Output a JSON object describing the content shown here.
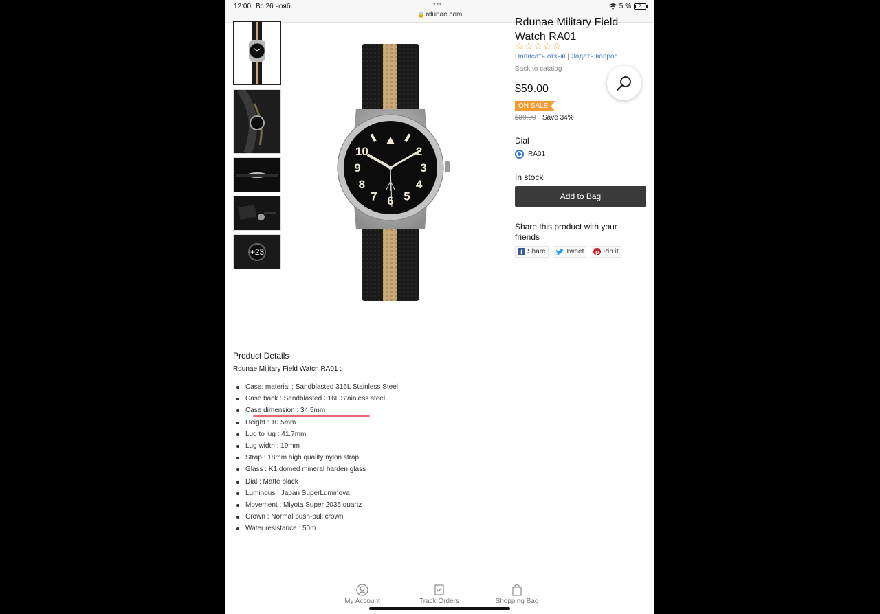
{
  "status_bar": {
    "time": "12:00",
    "date": "Вс 26 нояб.",
    "url": "rdunae.com",
    "battery": "5 %",
    "battery_level": 0.05
  },
  "gallery": {
    "more_label": "+23"
  },
  "product": {
    "title": "Rdunae Military Field Watch RA01",
    "stars": "☆☆☆☆☆",
    "write_review": "Написать отзыв",
    "review_sep": "|",
    "ask_question": "Задать вопрос",
    "back_to_catalog": "Back to catalog",
    "price": "$59.00",
    "sale_badge": "ON SALE",
    "old_price": "$89.00",
    "save": "Save 34%",
    "dial_label": "Dial",
    "dial_option": "RA01",
    "stock": "In stock",
    "add_to_bag": "Add to Bag",
    "share_title": "Share this product with your friends",
    "share": "Share",
    "tweet": "Tweet",
    "pin": "Pin it"
  },
  "watch_dial": {
    "numerals": [
      "10",
      "2",
      "9",
      "3",
      "8",
      "4",
      "7",
      "6",
      "5"
    ],
    "colors": {
      "strap": "#1a1a1a",
      "stripe": "#c9a978",
      "case": "#b9b9b9",
      "dial": "#0c0c0c"
    }
  },
  "details": {
    "title": "Product Details",
    "subtitle": "Rdunae Military Field Watch RA01 :",
    "specs": [
      "Case: material : Sandblasted 316L Stainless Steel",
      "Case back : Sandblasted 316L Stainless steel",
      "Case dimension : 34.5mm",
      "Height : 10.5mm",
      "Lug to lug : 41.7mm",
      "Lug width : 19mm",
      "Strap : 18mm high quality nylon strap",
      "Glass : K1 domed mineral harden glass",
      "Dial : Matte black",
      "Luminous : Japan SuperLuminova",
      "Movement : Miyota Super 2035 quartz",
      "Crown : Normal push-pull crown",
      "Water resistance : 50m"
    ]
  },
  "bottom_nav": {
    "account": "My Account",
    "track": "Track Orders",
    "bag": "Shopping Bag"
  },
  "colors": {
    "accent_blue": "#3a78c9",
    "sale_orange": "#f39c33",
    "star_orange": "#f5a623",
    "button_dark": "#3a3a3a",
    "annotation_red": "#e46a78"
  }
}
